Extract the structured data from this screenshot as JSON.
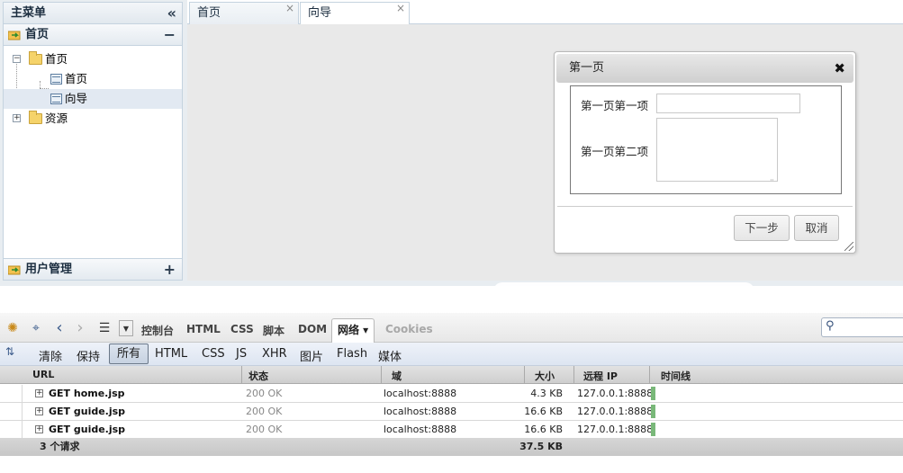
{
  "sidebar": {
    "title": "主菜单",
    "collapse_icon": "«",
    "section_home": {
      "label": "首页",
      "toggle": "−"
    },
    "tree": {
      "root_home": "首页",
      "child_home": "首页",
      "child_guide": "向导",
      "root_resources": "资源"
    },
    "section_users": {
      "label": "用户管理",
      "toggle": "+"
    }
  },
  "tabs": [
    {
      "label": "首页",
      "close": "×"
    },
    {
      "label": "向导",
      "close": "×"
    }
  ],
  "dialog": {
    "title": "第一页",
    "close": "✖",
    "field1_label": "第一页第一项",
    "field1_value": "",
    "field2_label": "第一页第二项",
    "field2_value": "",
    "next_button": "下一步",
    "cancel_button": "取消"
  },
  "firebug": {
    "toolbar_tabs": [
      "控制台",
      "HTML",
      "CSS",
      "脚本",
      "DOM",
      "网络 ▾",
      "Cookies"
    ],
    "active_tab": "网络 ▾",
    "search_placeholder": "",
    "filters": [
      "清除",
      "保持",
      "所有",
      "HTML",
      "CSS",
      "JS",
      "XHR",
      "图片",
      "Flash",
      "媒体"
    ],
    "active_filter": "所有",
    "columns": [
      "URL",
      "状态",
      "域",
      "大小",
      "远程 IP",
      "时间线"
    ],
    "requests": [
      {
        "url": "GET home.jsp",
        "status": "200 OK",
        "domain": "localhost:8888",
        "size": "4.3 KB",
        "ip": "127.0.0.1:8888"
      },
      {
        "url": "GET guide.jsp",
        "status": "200 OK",
        "domain": "localhost:8888",
        "size": "16.6 KB",
        "ip": "127.0.0.1:8888"
      },
      {
        "url": "GET guide.jsp",
        "status": "200 OK",
        "domain": "localhost:8888",
        "size": "16.6 KB",
        "ip": "127.0.0.1:8888"
      }
    ],
    "summary_count": "3 个请求",
    "summary_size": "37.5 KB",
    "timeline_color": "#79b879"
  }
}
